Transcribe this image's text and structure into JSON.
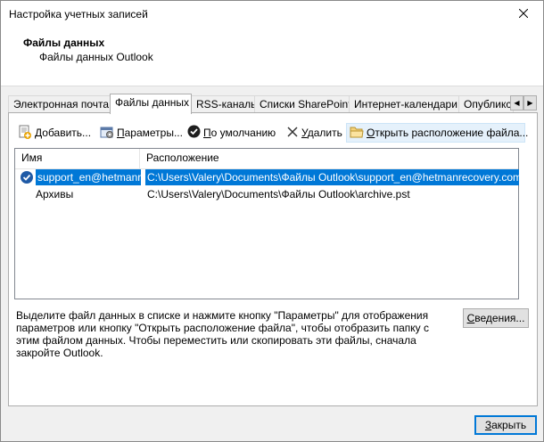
{
  "window": {
    "title": "Настройка учетных записей"
  },
  "header": {
    "title": "Файлы данных",
    "subtitle": "Файлы данных Outlook"
  },
  "tabs": [
    {
      "label": "Электронная почта"
    },
    {
      "label": "Файлы данных"
    },
    {
      "label": "RSS-каналы"
    },
    {
      "label": "Списки SharePoint"
    },
    {
      "label": "Интернет-календари"
    },
    {
      "label": "Опубликс"
    }
  ],
  "toolbar": {
    "add": {
      "u": "Д",
      "rest": "обавить..."
    },
    "settings": {
      "u": "П",
      "rest": "араметры..."
    },
    "default": {
      "u": "П",
      "rest": "о умолчанию"
    },
    "delete": {
      "u": "У",
      "rest": "далить"
    },
    "open_location": {
      "u": "О",
      "rest": "ткрыть расположение файла..."
    }
  },
  "list": {
    "col_name": "Имя",
    "col_location": "Расположение",
    "rows": [
      {
        "name": "support_en@hetmanrecovery.com",
        "path": "C:\\Users\\Valery\\Documents\\Файлы Outlook\\support_en@hetmanrecovery.com.ost"
      },
      {
        "name": "Архивы",
        "path": "C:\\Users\\Valery\\Documents\\Файлы Outlook\\archive.pst"
      }
    ]
  },
  "description": "Выделите файл данных в списке и нажмите кнопку \"Параметры\" для отображения параметров или кнопку \"Открыть расположение файла\", чтобы отобразить папку с этим файлом данных. Чтобы переместить или скопировать эти файлы, сначала закройте Outlook.",
  "buttons": {
    "details": {
      "u": "С",
      "rest": "ведения..."
    },
    "close": {
      "u": "З",
      "rest": "акрыть"
    }
  }
}
